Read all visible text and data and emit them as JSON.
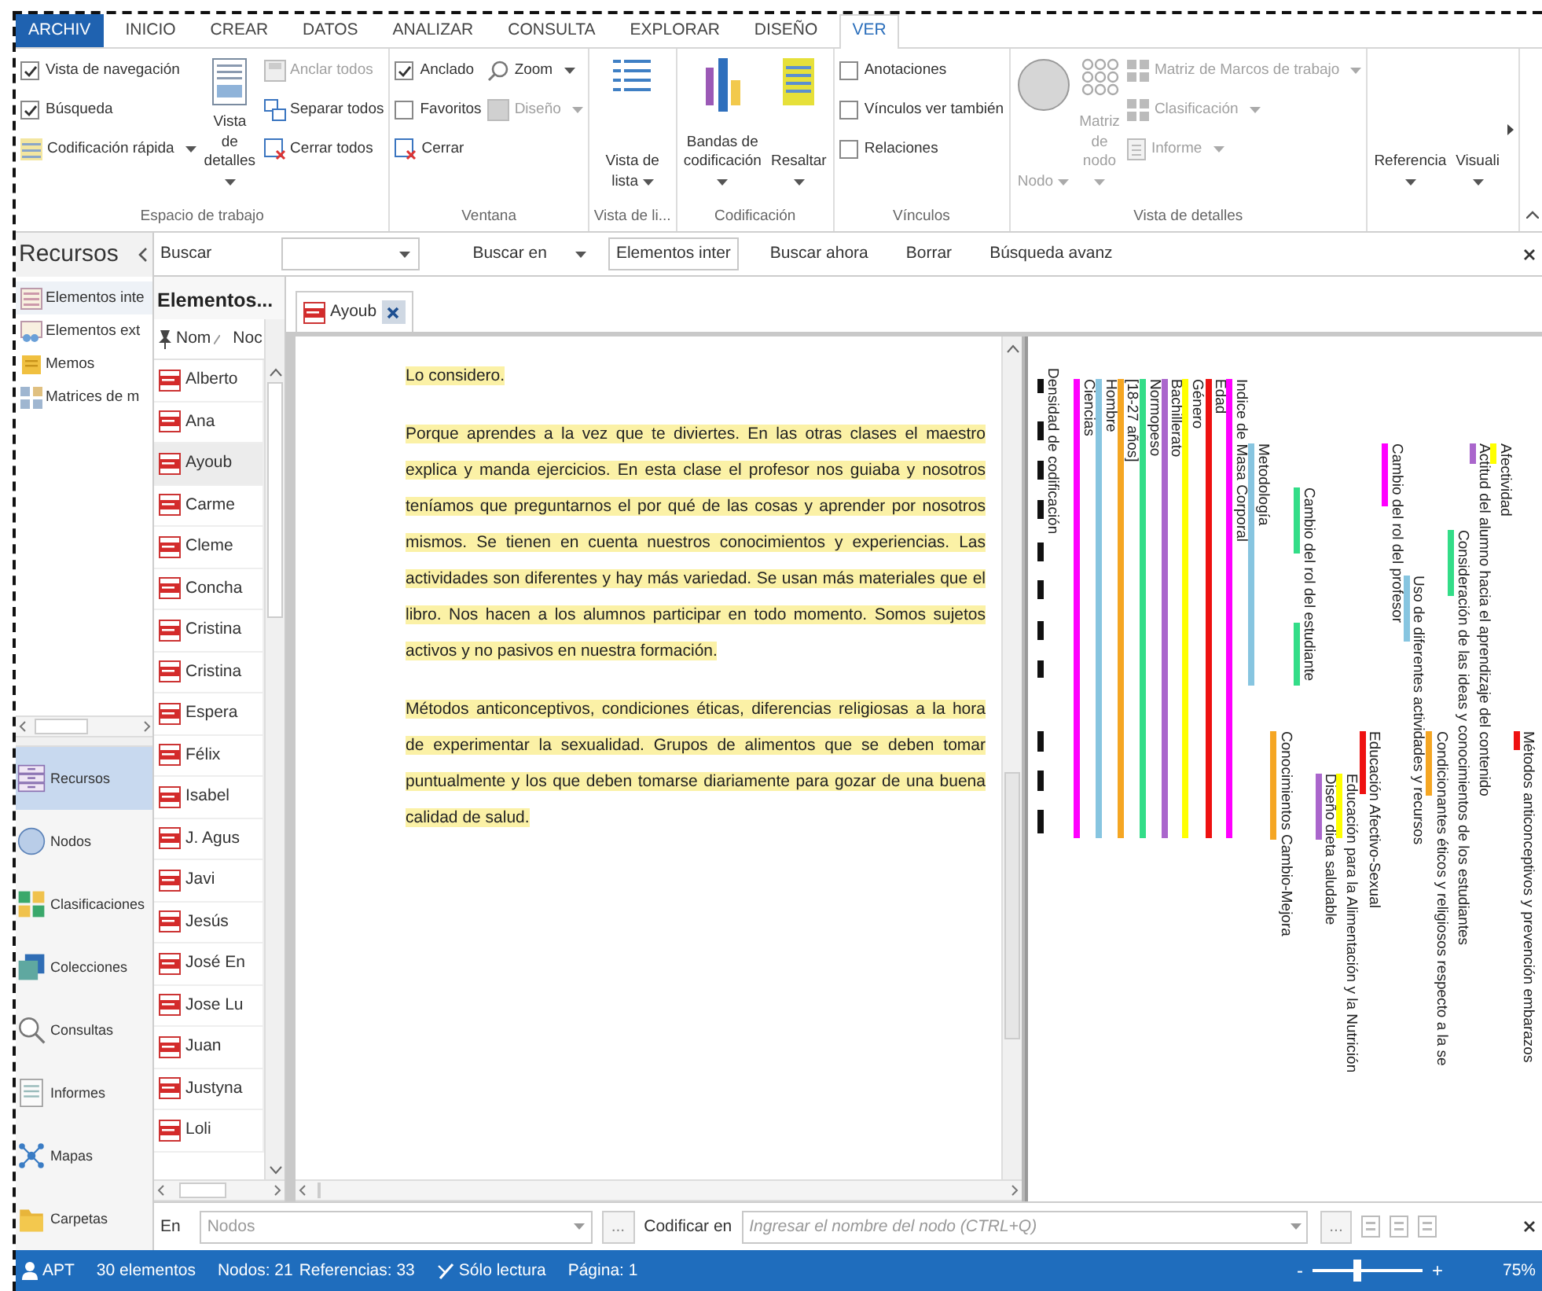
{
  "ribbon_tabs": [
    {
      "label": "ARCHIV",
      "kind": "file",
      "selected": false
    },
    {
      "label": "INICIO",
      "kind": "tab",
      "selected": false
    },
    {
      "label": "CREAR",
      "kind": "tab",
      "selected": false
    },
    {
      "label": "DATOS",
      "kind": "tab",
      "selected": false
    },
    {
      "label": "ANALIZAR",
      "kind": "tab",
      "selected": false
    },
    {
      "label": "CONSULTA",
      "kind": "tab",
      "selected": false
    },
    {
      "label": "EXPLORAR",
      "kind": "tab",
      "selected": false
    },
    {
      "label": "DISEÑO",
      "kind": "tab",
      "selected": false
    },
    {
      "label": "VER",
      "kind": "tab",
      "selected": true
    }
  ],
  "ribbon_groups": [
    {
      "label": "Espacio de trabajo",
      "columns": [
        [
          {
            "kind": "check",
            "label": "Vista de navegación",
            "checked": true
          },
          {
            "kind": "check",
            "label": "Búsqueda",
            "checked": true
          },
          {
            "kind": "small",
            "label": "Codificación rápida",
            "dropdown": true,
            "disabled": false
          }
        ],
        [
          {
            "kind": "large",
            "label": "Vista de detalles",
            "dropdown": true,
            "disabled": false
          }
        ],
        [
          {
            "kind": "small",
            "label": "Anclar todos",
            "dropdown": false,
            "disabled": true
          },
          {
            "kind": "small",
            "label": "Separar todos",
            "dropdown": false,
            "disabled": false
          },
          {
            "kind": "small",
            "label": "Cerrar todos",
            "dropdown": false,
            "disabled": false
          }
        ]
      ]
    },
    {
      "label": "Ventana",
      "columns": [
        [
          {
            "kind": "check",
            "label": "Anclado",
            "checked": true
          },
          {
            "kind": "check",
            "label": "Favoritos",
            "checked": false
          },
          {
            "kind": "small",
            "label": "Cerrar",
            "dropdown": false,
            "disabled": false
          }
        ],
        [
          {
            "kind": "small",
            "label": "Zoom",
            "dropdown": true,
            "disabled": false
          },
          {
            "kind": "small",
            "label": "Diseño",
            "dropdown": true,
            "disabled": true
          }
        ]
      ]
    },
    {
      "label": "Vista de li...",
      "columns": [
        [
          {
            "kind": "large",
            "label": "Vista de lista",
            "dropdown": true,
            "disabled": false
          }
        ]
      ]
    },
    {
      "label": "Codificación",
      "columns": [
        [
          {
            "kind": "large",
            "label": "Bandas de codificación",
            "dropdown": true,
            "disabled": false
          }
        ],
        [
          {
            "kind": "large",
            "label": "Resaltar",
            "dropdown": true,
            "disabled": false
          }
        ]
      ]
    },
    {
      "label": "Vínculos",
      "columns": [
        [
          {
            "kind": "check",
            "label": "Anotaciones",
            "checked": false
          },
          {
            "kind": "check",
            "label": "Vínculos ver también",
            "checked": false
          },
          {
            "kind": "check",
            "label": "Relaciones",
            "checked": false
          }
        ]
      ]
    },
    {
      "label": "Vista de detalles",
      "columns": [
        [
          {
            "kind": "large",
            "label": "Nodo",
            "dropdown": true,
            "disabled": true
          }
        ],
        [
          {
            "kind": "large",
            "label": "Matriz de nodo",
            "dropdown": true,
            "disabled": true
          }
        ],
        [
          {
            "kind": "small",
            "label": "Matriz de Marcos de trabajo",
            "dropdown": true,
            "disabled": true
          },
          {
            "kind": "small",
            "label": "Clasificación",
            "dropdown": true,
            "disabled": true
          },
          {
            "kind": "small",
            "label": "Informe",
            "dropdown": true,
            "disabled": true
          }
        ]
      ]
    },
    {
      "columns": [
        [
          {
            "kind": "large",
            "label": "Referencia",
            "dropdown": true,
            "disabled": false
          }
        ],
        [
          {
            "kind": "large",
            "label": "Visuali",
            "dropdown": true,
            "disabled": false
          }
        ]
      ]
    }
  ],
  "navigation": {
    "title": "Recursos",
    "tree": [
      {
        "label": "Elementos inte",
        "selected": true
      },
      {
        "label": "Elementos ext",
        "selected": false
      },
      {
        "label": "Memos",
        "selected": false
      },
      {
        "label": "Matrices de m",
        "selected": false
      }
    ],
    "buttons": [
      {
        "label": "Recursos",
        "selected": true
      },
      {
        "label": "Nodos",
        "selected": false
      },
      {
        "label": "Clasificaciones",
        "selected": false
      },
      {
        "label": "Colecciones",
        "selected": false
      },
      {
        "label": "Consultas",
        "selected": false
      },
      {
        "label": "Informes",
        "selected": false
      },
      {
        "label": "Mapas",
        "selected": false
      },
      {
        "label": "Carpetas",
        "selected": false
      }
    ]
  },
  "search_bar": {
    "label": "Buscar",
    "scope_label": "Buscar en",
    "scope": "Elementos inter",
    "actions": [
      "Buscar ahora",
      "Borrar",
      "Búsqueda avanz"
    ]
  },
  "list": {
    "title": "Elementos...",
    "columns": [
      "Nom",
      "Noc"
    ],
    "rows": [
      {
        "name": "Alberto",
        "selected": false
      },
      {
        "name": "Ana",
        "selected": false
      },
      {
        "name": "Ayoub",
        "selected": true
      },
      {
        "name": "Carme",
        "selected": false
      },
      {
        "name": "Cleme",
        "selected": false
      },
      {
        "name": "Concha",
        "selected": false
      },
      {
        "name": "Cristina",
        "selected": false
      },
      {
        "name": "Cristina",
        "selected": false
      },
      {
        "name": "Espera",
        "selected": false
      },
      {
        "name": "Félix",
        "selected": false
      },
      {
        "name": "Isabel",
        "selected": false
      },
      {
        "name": "J. Agus",
        "selected": false
      },
      {
        "name": "Javi",
        "selected": false
      },
      {
        "name": "Jesús",
        "selected": false
      },
      {
        "name": "José En",
        "selected": false
      },
      {
        "name": "Jose Lu",
        "selected": false
      },
      {
        "name": "Juan",
        "selected": false
      },
      {
        "name": "Justyna",
        "selected": false
      },
      {
        "name": "Loli",
        "selected": false
      }
    ]
  },
  "document": {
    "tab": "Ayoub",
    "paragraphs": [
      {
        "text": "Lo considero.",
        "highlighted": true
      },
      {
        "text": "Porque aprendes a la vez que te diviertes. En las otras clases el maestro explica y manda ejercicios. En esta clase el profesor nos guiaba y nosotros teníamos que preguntarnos el por qué de las cosas y aprender por nosotros mismos. Se tienen en cuenta nuestros conocimientos y experiencias. Las actividades son diferentes y hay más variedad. Se usan más materiales que el libro. Nos hacen a los alumnos participar en todo momento. Somos sujetos activos y no pasivos en nuestra formación.",
        "highlighted": true
      },
      {
        "text": "Métodos anticonceptivos, condiciones éticas, diferencias religiosas a la hora de experimentar la sexualidad. Grupos de alimentos que se deben tomar puntualmente y los que deben tomarse diariamente para gozar de una buena calidad de salud.",
        "highlighted": true
      }
    ]
  },
  "stripes": {
    "density_label": "Densidad de codificación",
    "items": [
      {
        "label": "Ciencias",
        "color": "#ff00ff"
      },
      {
        "label": "Hombre",
        "color": "#87c5e0"
      },
      {
        "label": "[18-27 años]",
        "color": "#f5a623"
      },
      {
        "label": "Normopeso",
        "color": "#33dd88"
      },
      {
        "label": "Bachillerato",
        "color": "#aa66cc"
      },
      {
        "label": "Género",
        "color": "#ffff00"
      },
      {
        "label": "Edad",
        "color": "#ee1111"
      },
      {
        "label": "Indice de Masa Corporal",
        "color": "#ff00ff"
      },
      {
        "label": "Metodología",
        "color": "#87c5e0"
      },
      {
        "label": "Conocimientos Cambio-Mejora",
        "color": "#f5a623"
      },
      {
        "label": "Cambio del rol del estudiante",
        "color": "#33dd88"
      },
      {
        "label": "Diseño dieta saludable",
        "color": "#aa66cc"
      },
      {
        "label": "Educación para la Alimentación y la Nutrición",
        "color": "#ffff00"
      },
      {
        "label": "Educación Afectivo-Sexual",
        "color": "#ee1111"
      },
      {
        "label": "Cambio del rol del profesor",
        "color": "#ff00ff"
      },
      {
        "label": "Uso de diferentes actividades y recursos",
        "color": "#87c5e0"
      },
      {
        "label": "Condicionantes éticos y religiosos respecto a la se",
        "color": "#f5a623"
      },
      {
        "label": "Consideración de las ideas y conocimientos de los estudiantes",
        "color": "#33dd88"
      },
      {
        "label": "Actitud del alumno hacia el aprendizaje del contenido",
        "color": "#aa66cc"
      },
      {
        "label": "Afectividad",
        "color": "#ffff00"
      },
      {
        "label": "Métodos anticonceptivos y prevención embarazos",
        "color": "#ee1111"
      }
    ]
  },
  "coding_bar": {
    "in_label": "En",
    "in_value": "Nodos",
    "browse": "...",
    "code_label": "Codificar en",
    "node_placeholder": "Ingresar el nombre del nodo (CTRL+Q)",
    "browse_node": "..."
  },
  "status_bar": {
    "user": "APT",
    "count": "30 elementos",
    "nodes": "Nodos: 21",
    "references": "Referencias: 33",
    "mode": "Sólo lectura",
    "page": "Página: 1",
    "zoom": {
      "minus": "-",
      "plus": "+",
      "level": 0.4,
      "reading": "75%"
    }
  }
}
